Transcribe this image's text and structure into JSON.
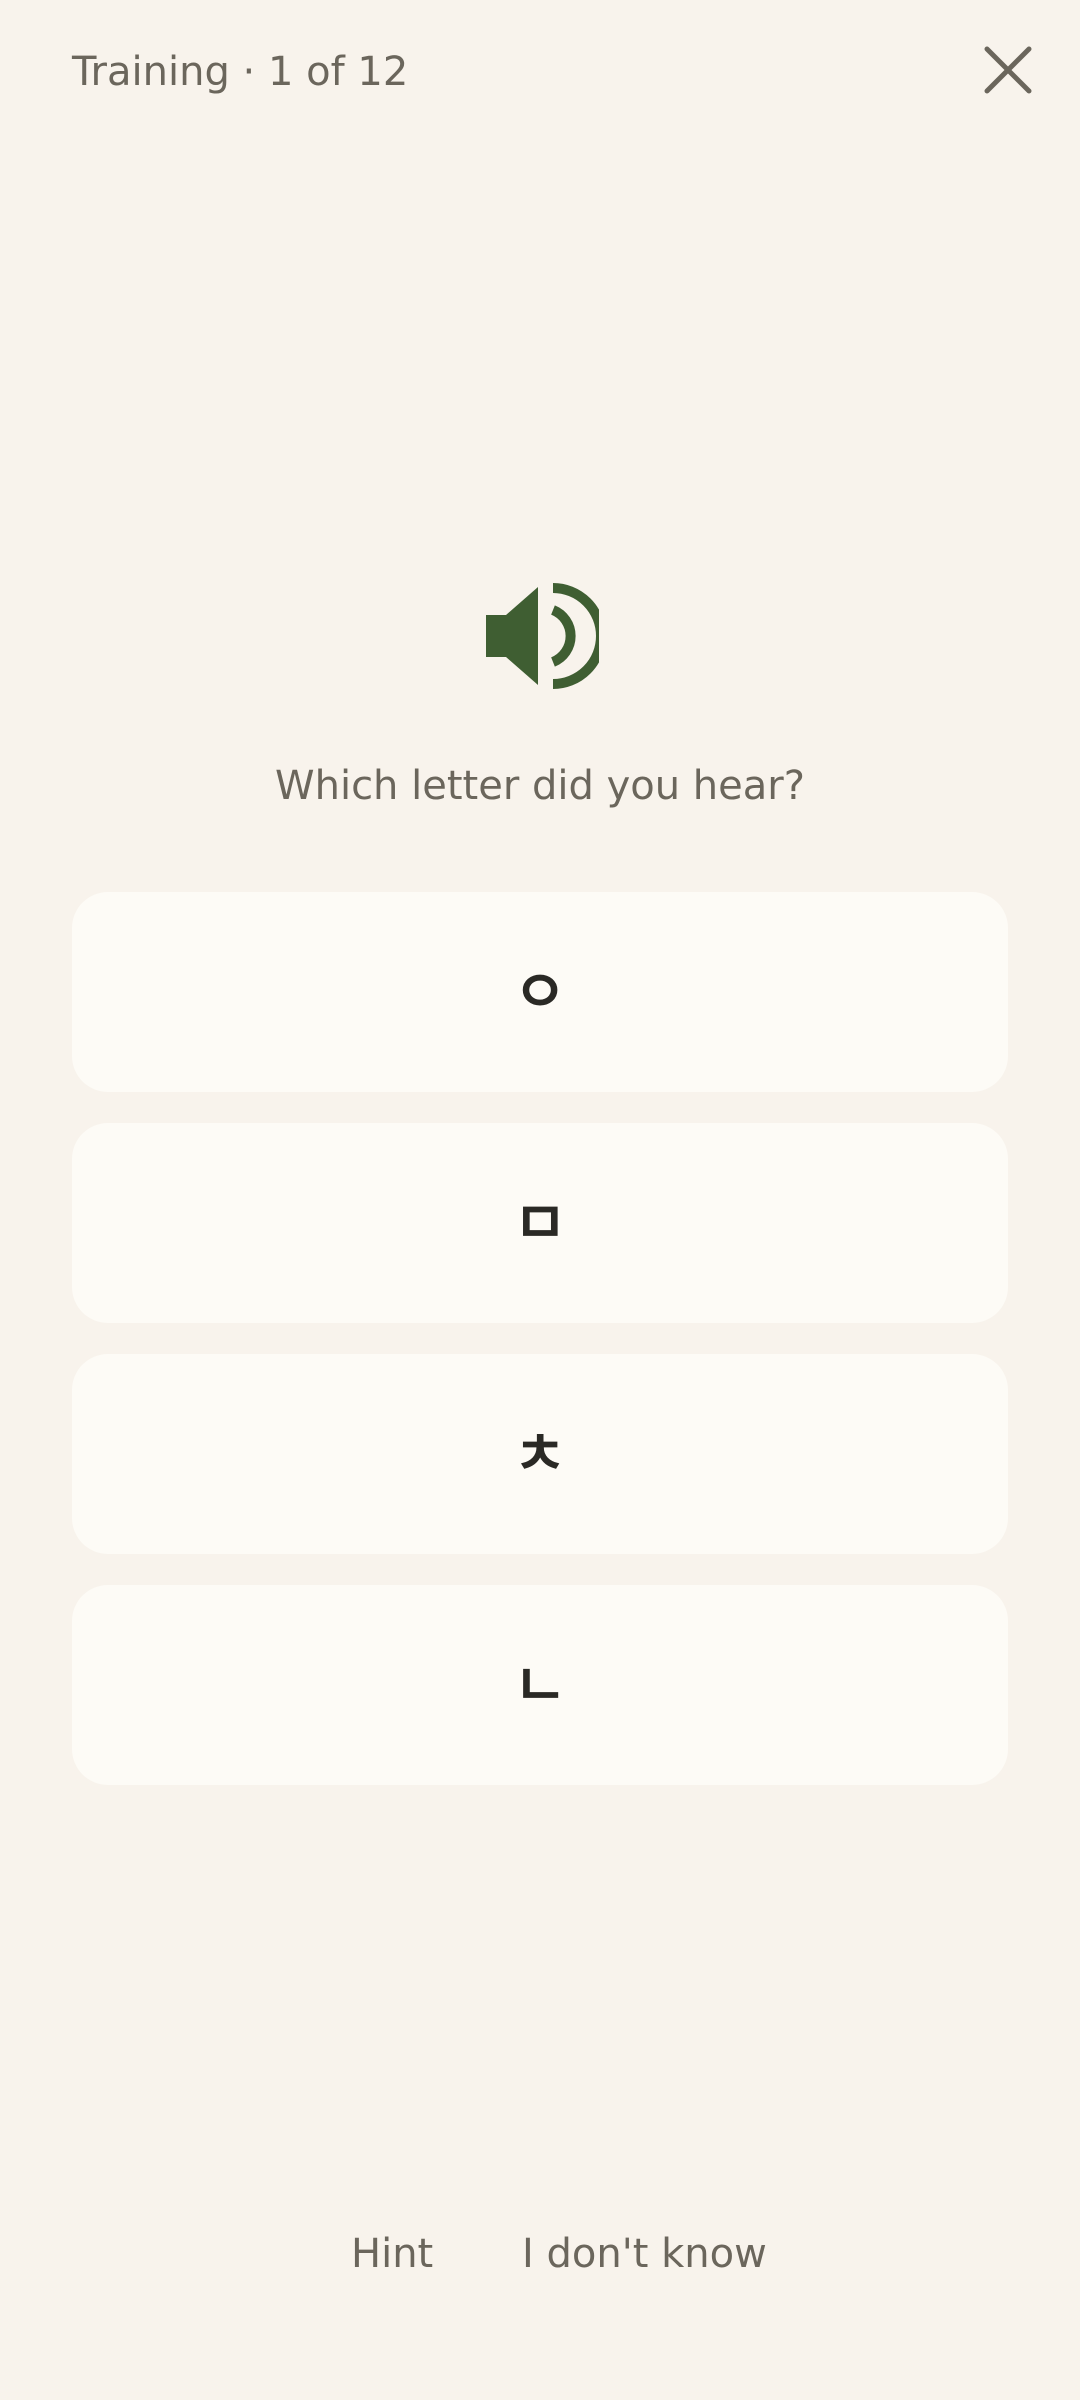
{
  "header": {
    "title": "Training · 1 of 12",
    "close_icon": "close-icon"
  },
  "audio": {
    "icon": "speaker-icon",
    "color": "#3f5e32"
  },
  "prompt": "Which letter did you hear?",
  "options": [
    {
      "letter": "ㅇ"
    },
    {
      "letter": "ㅁ"
    },
    {
      "letter": "ㅊ"
    },
    {
      "letter": "ㄴ"
    }
  ],
  "footer": {
    "hint_label": "Hint",
    "dont_know_label": "I don't know"
  },
  "colors": {
    "background": "#f8f3ec",
    "card": "#fdfbf6",
    "text_muted": "#6b665c",
    "text_dark": "#2a2925",
    "accent": "#3f5e32"
  }
}
